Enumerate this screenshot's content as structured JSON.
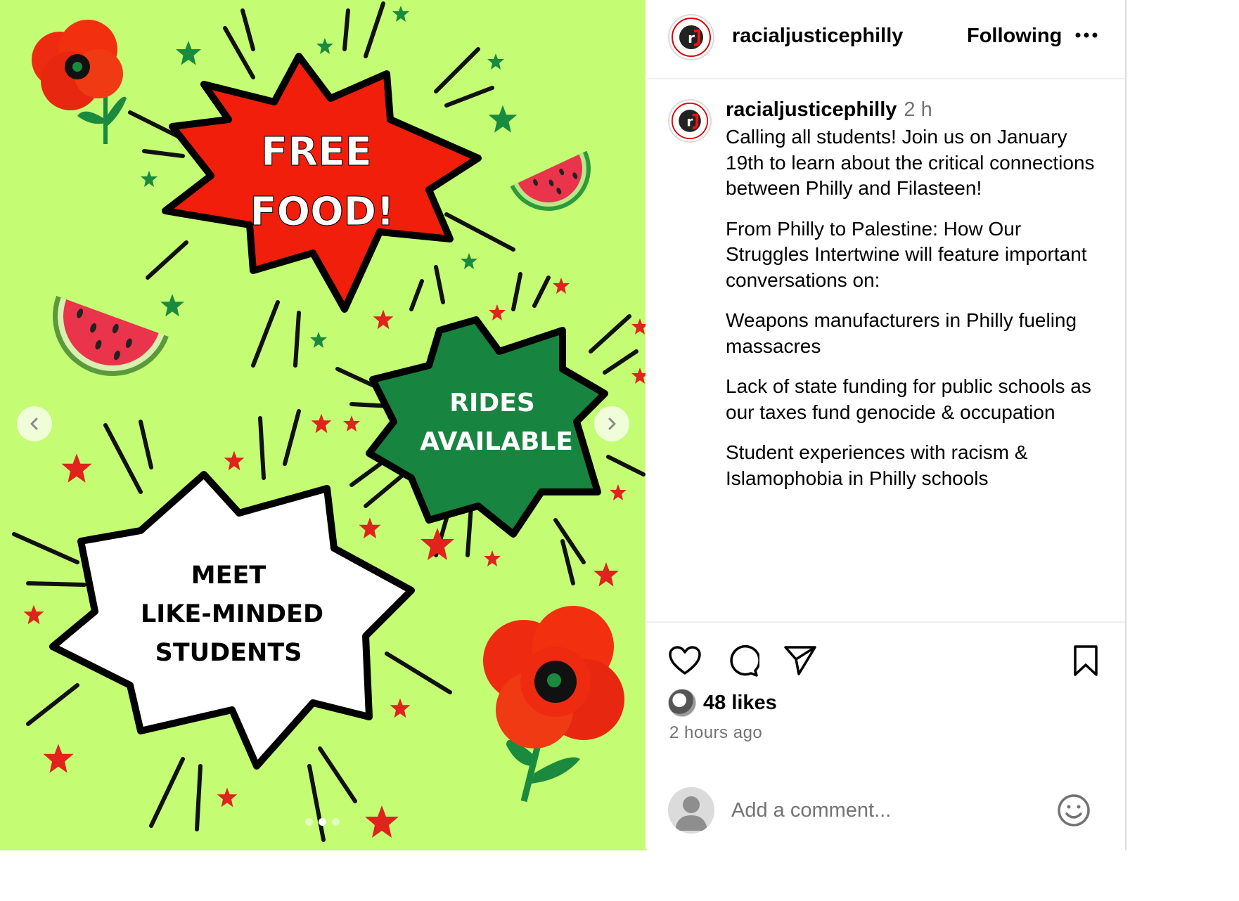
{
  "media": {
    "headline_free_food_line1": "FREE",
    "headline_free_food_line2": "FOOD!",
    "rides_line1": "RIDES",
    "rides_line2": "AVAILABLE",
    "meet_line1": "MEET",
    "meet_line2": "LIKE-MINDED",
    "meet_line3": "STUDENTS",
    "background_color": "#c4fc74",
    "prev_icon": "chevron-left-icon",
    "next_icon": "chevron-right-icon",
    "carousel_index": 2,
    "carousel_count": 3
  },
  "header": {
    "username": "racialjusticephilly",
    "follow_label": "Following",
    "more_icon": "more-icon"
  },
  "caption": {
    "username": "racialjusticephilly",
    "time": "2 h",
    "paragraphs": [
      "Calling all students! Join us on January 19th to learn about the critical connections between Philly and Filasteen!",
      "From Philly to Palestine: How Our Struggles Intertwine will feature important conversations on:",
      "Weapons manufacturers in Philly fueling massacres",
      "Lack of state funding for public schools as our taxes fund genocide & occupation",
      "Student experiences with racism & Islamophobia in Philly schools"
    ]
  },
  "actions": {
    "like_icon": "heart-icon",
    "comment_icon": "comment-icon",
    "share_icon": "send-icon",
    "save_icon": "bookmark-icon",
    "likes": "48 likes",
    "posted": "2 hours ago"
  },
  "comment": {
    "placeholder": "Add a comment...",
    "emoji_icon": "smiley-icon"
  },
  "colors": {
    "red": "#f01e0a",
    "green": "#15803d",
    "text_secondary": "#737373"
  }
}
